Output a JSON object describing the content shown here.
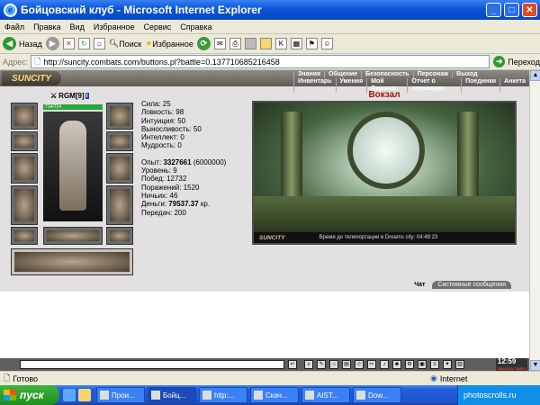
{
  "window": {
    "title": "Бойцовский клуб - Microsoft Internet Explorer"
  },
  "menu": [
    "Файл",
    "Правка",
    "Вид",
    "Избранное",
    "Сервис",
    "Справка"
  ],
  "toolbar": {
    "back": "Назад",
    "search": "Поиск",
    "favorites": "Избранное"
  },
  "address": {
    "label": "Адрес:",
    "url": "http://suncity.combats.com/buttons.pl?battle=0.137710685216458",
    "go": "Переход"
  },
  "game": {
    "logo": "SUNCITY",
    "nav_top": [
      "Знания",
      "Общение",
      "Безопасность",
      "Персонаж",
      "Выход"
    ],
    "nav_bottom": [
      "Инвентарь",
      "Умения",
      "Мой Скроллл",
      "Отчет о переводах",
      "Поединки",
      "Анкета"
    ],
    "character": {
      "nick": "RGM",
      "level": "[9]",
      "badge": "i",
      "hp": "714/714"
    },
    "stats": {
      "strength": "Сила: 25",
      "agility": "Ловкость: 98",
      "intuition": "Интуиция: 50",
      "endurance": "Выносливость: 50",
      "intellect": "Интеллект: 0",
      "wisdom": "Мудрость: 0",
      "exp_label": "Опыт:",
      "exp_value": "3327661",
      "exp_next": "(6000000)",
      "level": "Уровень: 9",
      "wins": "Побед: 12732",
      "losses": "Поражений: 1520",
      "draws": "Ничьих: 46",
      "money_label": "Деньги:",
      "money_value": "79537.37",
      "money_unit": "кр.",
      "transfers": "Передач: 200"
    },
    "location": "Вокзал",
    "scene_brand": "SUNCITY",
    "scene_message": "Время до телепортации в Dreams city: 04:49:23",
    "tabs": [
      "Чат",
      "Системные сообщения"
    ],
    "clock": "12:59",
    "clock_sub": "DRAGON TIMES"
  },
  "status": {
    "left": "Готово",
    "right": "Internet"
  },
  "taskbar": {
    "start": "пуск",
    "tasks": [
      "Прои...",
      "Бойц...",
      "http:...",
      "Скач...",
      "AIST...",
      "Dow..."
    ],
    "tray": "photoscrolls.ru"
  }
}
